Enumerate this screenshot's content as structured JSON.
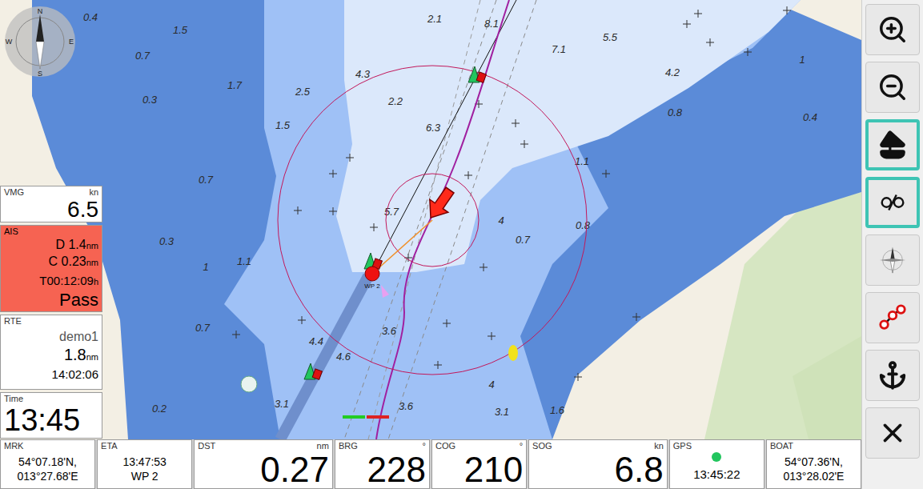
{
  "map": {
    "compass": {
      "n": "N",
      "s": "S",
      "w": "W",
      "e": "E"
    },
    "waypoint_label": "WP 2",
    "soundings": [
      "0.4",
      "1.5",
      "0.7",
      "1.7",
      "0.3",
      "2.5",
      "4.3",
      "2.2",
      "2.1",
      "8.1",
      "7.1",
      "5.5",
      "4.2",
      "0.8",
      "0.4",
      "1",
      "1.5",
      "6.3",
      "0.7",
      "1.1",
      "5.7",
      "4",
      "0.7",
      "0.8",
      "0.3",
      "1",
      "1.1",
      "0.7",
      "3.6",
      "4.4",
      "4.6",
      "3.1",
      "3.6",
      "4",
      "3.1",
      "1.6",
      "0.2"
    ]
  },
  "widgets": {
    "vmg": {
      "label": "VMG",
      "unit": "kn",
      "value": "6.5"
    },
    "ais": {
      "label": "AIS",
      "alarm": true,
      "color": "#f66352",
      "distance_label": "D",
      "distance": "1.4",
      "distance_unit": "nm",
      "cpa_label": "C",
      "cpa": "0.23",
      "cpa_unit": "nm",
      "tcpa": "T00:12:09",
      "tcpa_unit": "h",
      "status": "Pass"
    },
    "route": {
      "label": "RTE",
      "name": "demo1",
      "distance": "1.8",
      "unit": "nm",
      "eta": "14:02:06"
    },
    "time": {
      "label": "Time",
      "value": "13:45"
    }
  },
  "bottom_bar": [
    {
      "kind": "pos",
      "label": "MRK",
      "unit": "",
      "lines": [
        "54°07.18'N,",
        "013°27.68'E"
      ]
    },
    {
      "kind": "pos",
      "label": "ETA",
      "unit": "",
      "lines": [
        "13:47:53",
        "WP 2"
      ]
    },
    {
      "kind": "big",
      "label": "DST",
      "unit": "nm",
      "lines": [
        "0.27"
      ]
    },
    {
      "kind": "mid",
      "label": "BRG",
      "unit": "°",
      "lines": [
        "228"
      ]
    },
    {
      "kind": "mid",
      "label": "COG",
      "unit": "°",
      "lines": [
        "210"
      ]
    },
    {
      "kind": "big",
      "label": "SOG",
      "unit": "kn",
      "lines": [
        "6.8"
      ]
    },
    {
      "kind": "gps",
      "label": "GPS",
      "unit": "",
      "color": "#22c55e",
      "lines": [
        "13:45:22"
      ]
    },
    {
      "kind": "pos",
      "label": "BOAT",
      "unit": "",
      "lines": [
        "54°07.36'N,",
        "013°28.02'E"
      ]
    }
  ],
  "toolbar": [
    {
      "kind": "zoom-in",
      "selected": false
    },
    {
      "kind": "zoom-out",
      "selected": false
    },
    {
      "kind": "boat",
      "selected": true
    },
    {
      "kind": "lock",
      "selected": true
    },
    {
      "kind": "compass",
      "selected": false
    },
    {
      "kind": "route",
      "selected": false
    },
    {
      "kind": "anchor",
      "selected": false
    },
    {
      "kind": "close",
      "selected": false
    }
  ]
}
